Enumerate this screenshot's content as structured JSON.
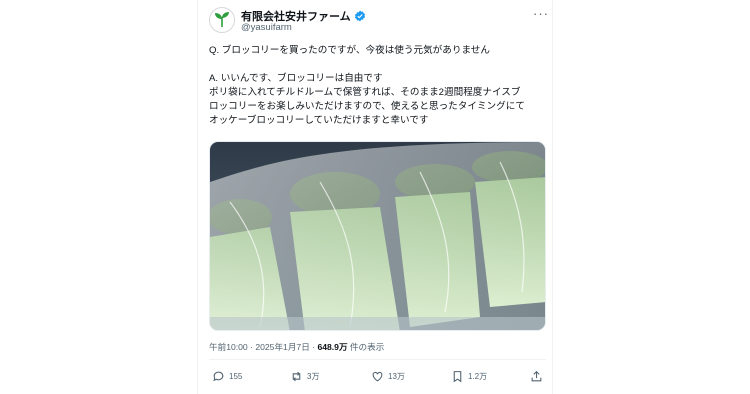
{
  "account": {
    "display_name": "有限会社安井ファーム",
    "handle": "@yasuifarm"
  },
  "tweet": {
    "line1": "Q. ブロッコリーを買ったのですが、今夜は使う元気がありません",
    "line2": "A. いいんです、ブロッコリーは自由です",
    "line3": "ポリ袋に入れてチルドルームで保管すれば、そのまま2週間程度ナイスブ",
    "line4": "ロッコリーをお楽しみいただけますので、使えると思ったタイミングにて",
    "line5": "オッケーブロッコリーしていただけますと幸いです"
  },
  "meta": {
    "time": "午前10:00 · 2025年1月7日 · ",
    "views": "648.9万",
    "views_label": " 件の表示"
  },
  "actions": {
    "reply_count": "155",
    "retweet_count": "3万",
    "like_count": "13万",
    "bookmark_count": "1.2万"
  },
  "colors": {
    "verified": "#1d9bf0",
    "logo_green": "#2e9e3e",
    "text_primary": "#0f1419",
    "text_secondary": "#536471"
  }
}
